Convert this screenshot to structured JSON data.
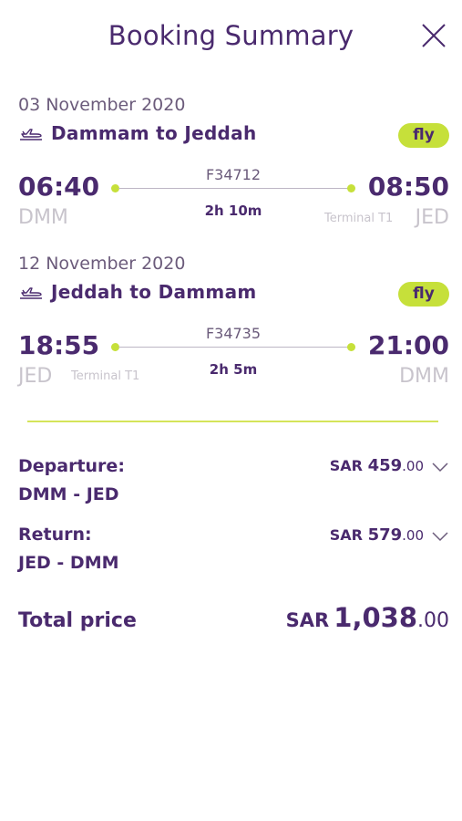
{
  "header": {
    "title": "Booking Summary",
    "close_icon": "close-icon"
  },
  "legs": [
    {
      "date": "03 November 2020",
      "route": "Dammam to Jeddah",
      "icon": "plane-departure-icon",
      "badge": "fly",
      "dep_time": "06:40",
      "dep_code": "DMM",
      "arr_time": "08:50",
      "arr_code": "JED",
      "terminal": "Terminal T1",
      "flight_no": "F34712",
      "duration": "2h 10m"
    },
    {
      "date": "12 November 2020",
      "route": "Jeddah to Dammam",
      "icon": "plane-departure-icon",
      "badge": "fly",
      "dep_time": "18:55",
      "dep_code": "JED",
      "arr_time": "21:00",
      "arr_code": "DMM",
      "terminal": "Terminal T1",
      "flight_no": "F34735",
      "duration": "2h 5m"
    }
  ],
  "prices": {
    "departure": {
      "label": "Departure:",
      "route": "DMM - JED",
      "currency": "SAR",
      "amount": "459",
      "decimals": ".00"
    },
    "return": {
      "label": "Return:",
      "route": "JED - DMM",
      "currency": "SAR",
      "amount": "579",
      "decimals": ".00"
    },
    "total": {
      "label": "Total price",
      "currency": "SAR",
      "amount": "1,038",
      "decimals": ".00"
    }
  },
  "colors": {
    "brand": "#4a2a6e",
    "accent": "#c6e03a",
    "muted": "#c8c4cc"
  }
}
